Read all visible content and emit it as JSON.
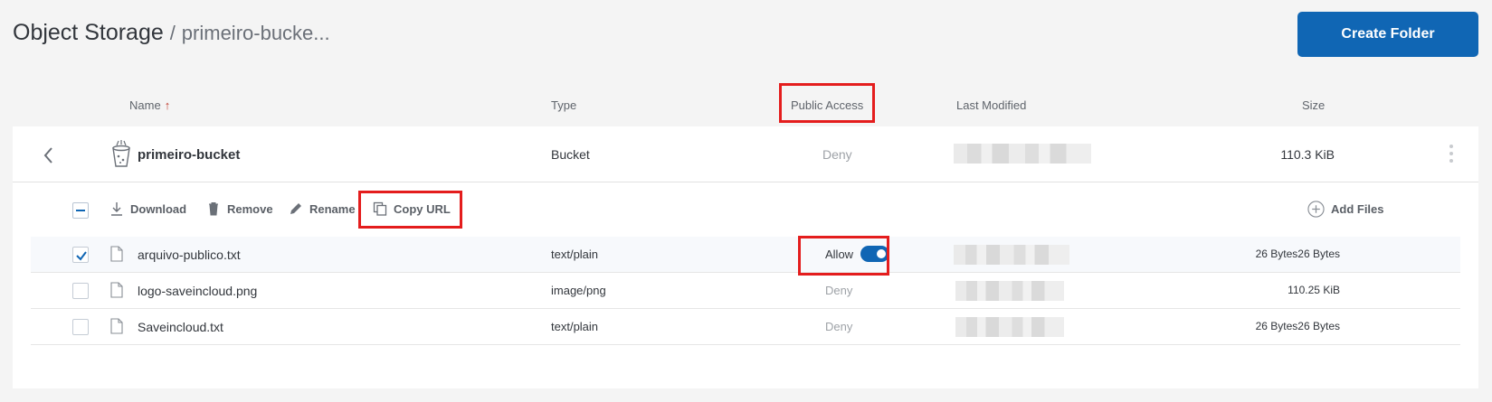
{
  "header": {
    "title": "Object Storage",
    "separator": "/",
    "breadcrumb": "primeiro-bucke...",
    "create_folder_label": "Create Folder"
  },
  "columns": {
    "name": "Name",
    "type": "Type",
    "public_access": "Public Access",
    "last_modified": "Last Modified",
    "size": "Size"
  },
  "bucket": {
    "name": "primeiro-bucket",
    "type": "Bucket",
    "access": "Deny",
    "size": "110.3 KiB"
  },
  "toolbar": {
    "download": "Download",
    "remove": "Remove",
    "rename": "Rename",
    "copy_url": "Copy URL",
    "add_files": "Add Files"
  },
  "files": [
    {
      "name": "arquivo-publico.txt",
      "type": "text/plain",
      "access": "Allow",
      "size": "26 Bytes26 Bytes",
      "selected": true
    },
    {
      "name": "logo-saveincloud.png",
      "type": "image/png",
      "access": "Deny",
      "size": "110.25 KiB",
      "selected": false
    },
    {
      "name": "Saveincloud.txt",
      "type": "text/plain",
      "access": "Deny",
      "size": "26 Bytes26 Bytes",
      "selected": false
    }
  ],
  "colors": {
    "accent": "#1066b4",
    "highlight": "#e41d1d",
    "sort_arrow": "#c03b2e"
  }
}
